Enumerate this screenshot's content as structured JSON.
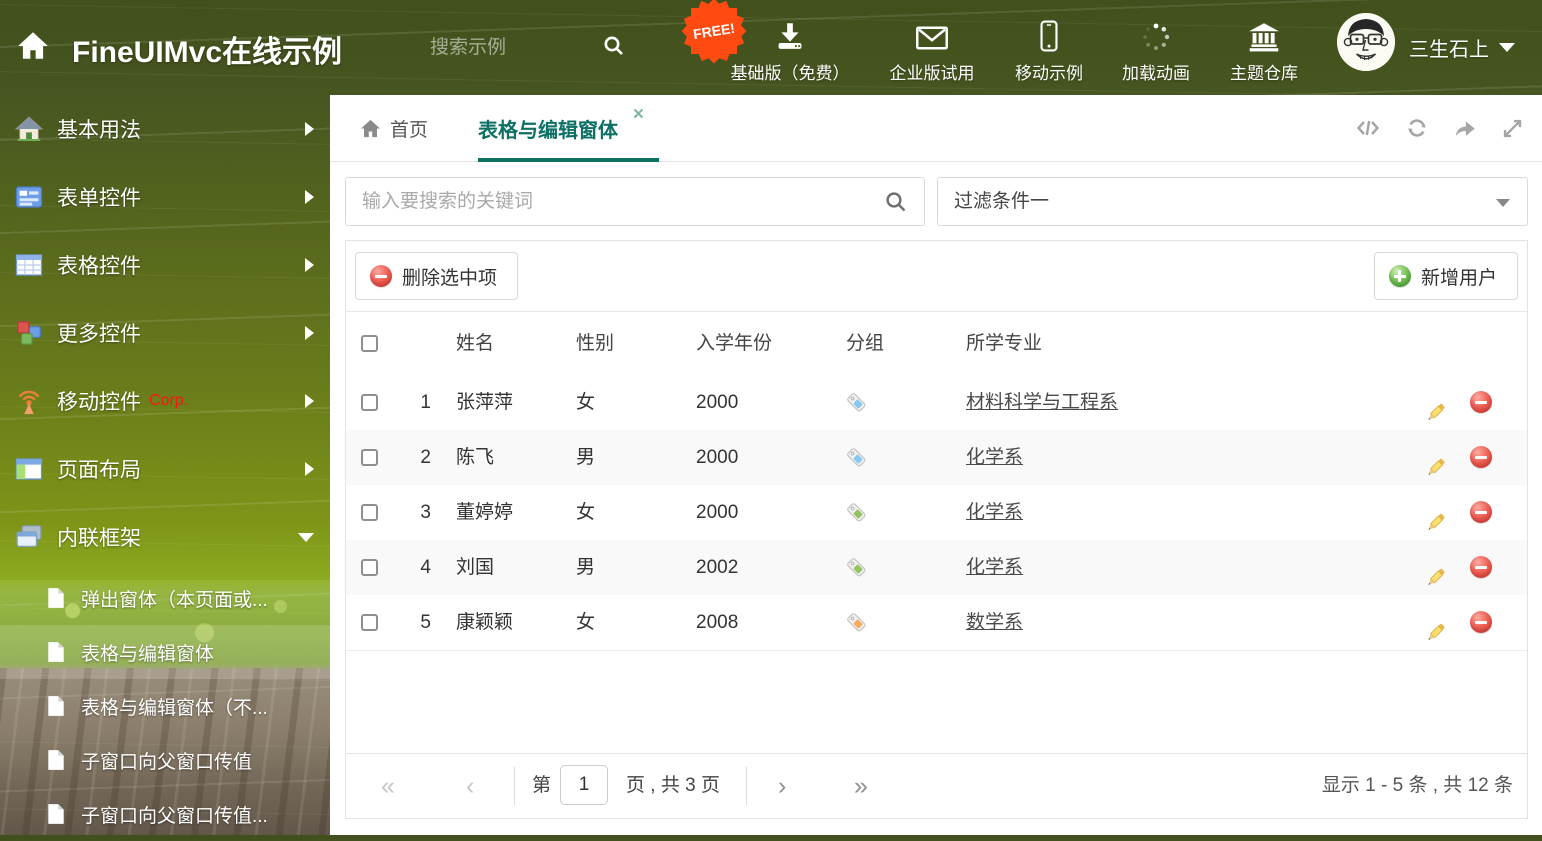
{
  "header": {
    "title": "FineUIMvc在线示例",
    "search_placeholder": "搜索示例",
    "free_badge": "FREE!",
    "nav": [
      {
        "label": "基础版（免费）",
        "icon": "download-icon"
      },
      {
        "label": "企业版试用",
        "icon": "envelope-icon"
      },
      {
        "label": "移动示例",
        "icon": "mobile-icon"
      },
      {
        "label": "加载动画",
        "icon": "spinner-icon"
      },
      {
        "label": "主题仓库",
        "icon": "bank-icon"
      }
    ],
    "username": "三生石上"
  },
  "sidebar": {
    "items": [
      {
        "label": "基本用法",
        "icon": "home-icon"
      },
      {
        "label": "表单控件",
        "icon": "form-icon"
      },
      {
        "label": "表格控件",
        "icon": "grid-icon"
      },
      {
        "label": "更多控件",
        "icon": "cubes-icon"
      },
      {
        "label": "移动控件",
        "icon": "antenna-icon",
        "badge": "Corp."
      },
      {
        "label": "页面布局",
        "icon": "layout-icon"
      },
      {
        "label": "内联框架",
        "icon": "frames-icon",
        "expanded": true
      }
    ],
    "subitems": [
      {
        "label": "弹出窗体（本页面或..."
      },
      {
        "label": "表格与编辑窗体",
        "selected": true
      },
      {
        "label": "表格与编辑窗体（不..."
      },
      {
        "label": "子窗口向父窗口传值"
      },
      {
        "label": "子窗口向父窗口传值..."
      }
    ]
  },
  "tabs": {
    "home_label": "首页",
    "active_label": "表格与编辑窗体"
  },
  "search_bar": {
    "placeholder": "输入要搜索的关键词",
    "filter_value": "过滤条件一"
  },
  "toolbar": {
    "delete_label": "删除选中项",
    "add_label": "新增用户"
  },
  "table": {
    "headers": {
      "name": "姓名",
      "gender": "性别",
      "year": "入学年份",
      "group": "分组",
      "major": "所学专业"
    },
    "rows": [
      {
        "num": "1",
        "name": "张萍萍",
        "gender": "女",
        "year": "2000",
        "tag_color": "#85c9f2",
        "major": "材料科学与工程系"
      },
      {
        "num": "2",
        "name": "陈飞",
        "gender": "男",
        "year": "2000",
        "tag_color": "#85c9f2",
        "major": "化学系"
      },
      {
        "num": "3",
        "name": "董婷婷",
        "gender": "女",
        "year": "2000",
        "tag_color": "#95c45e",
        "major": "化学系"
      },
      {
        "num": "4",
        "name": "刘国",
        "gender": "男",
        "year": "2002",
        "tag_color": "#95c45e",
        "major": "化学系"
      },
      {
        "num": "5",
        "name": "康颖颖",
        "gender": "女",
        "year": "2008",
        "tag_color": "#f6ac60",
        "major": "数学系"
      }
    ]
  },
  "pagination": {
    "first": "«",
    "prev": "‹",
    "page_prefix": "第",
    "page_value": "1",
    "page_suffix": "页 , 共 3 页",
    "next": "›",
    "last": "»",
    "summary": "显示 1 - 5 条 , 共 12 条"
  },
  "colors": {
    "accent_teal": "#0c7065",
    "delete_red": "#e8554d",
    "add_green": "#55b055",
    "corp_red": "#ff1414",
    "free_badge_bg": "#ff4a12",
    "tag_blue": "#85c9f2",
    "tag_green": "#95c45e",
    "tag_orange": "#f6ac60"
  }
}
